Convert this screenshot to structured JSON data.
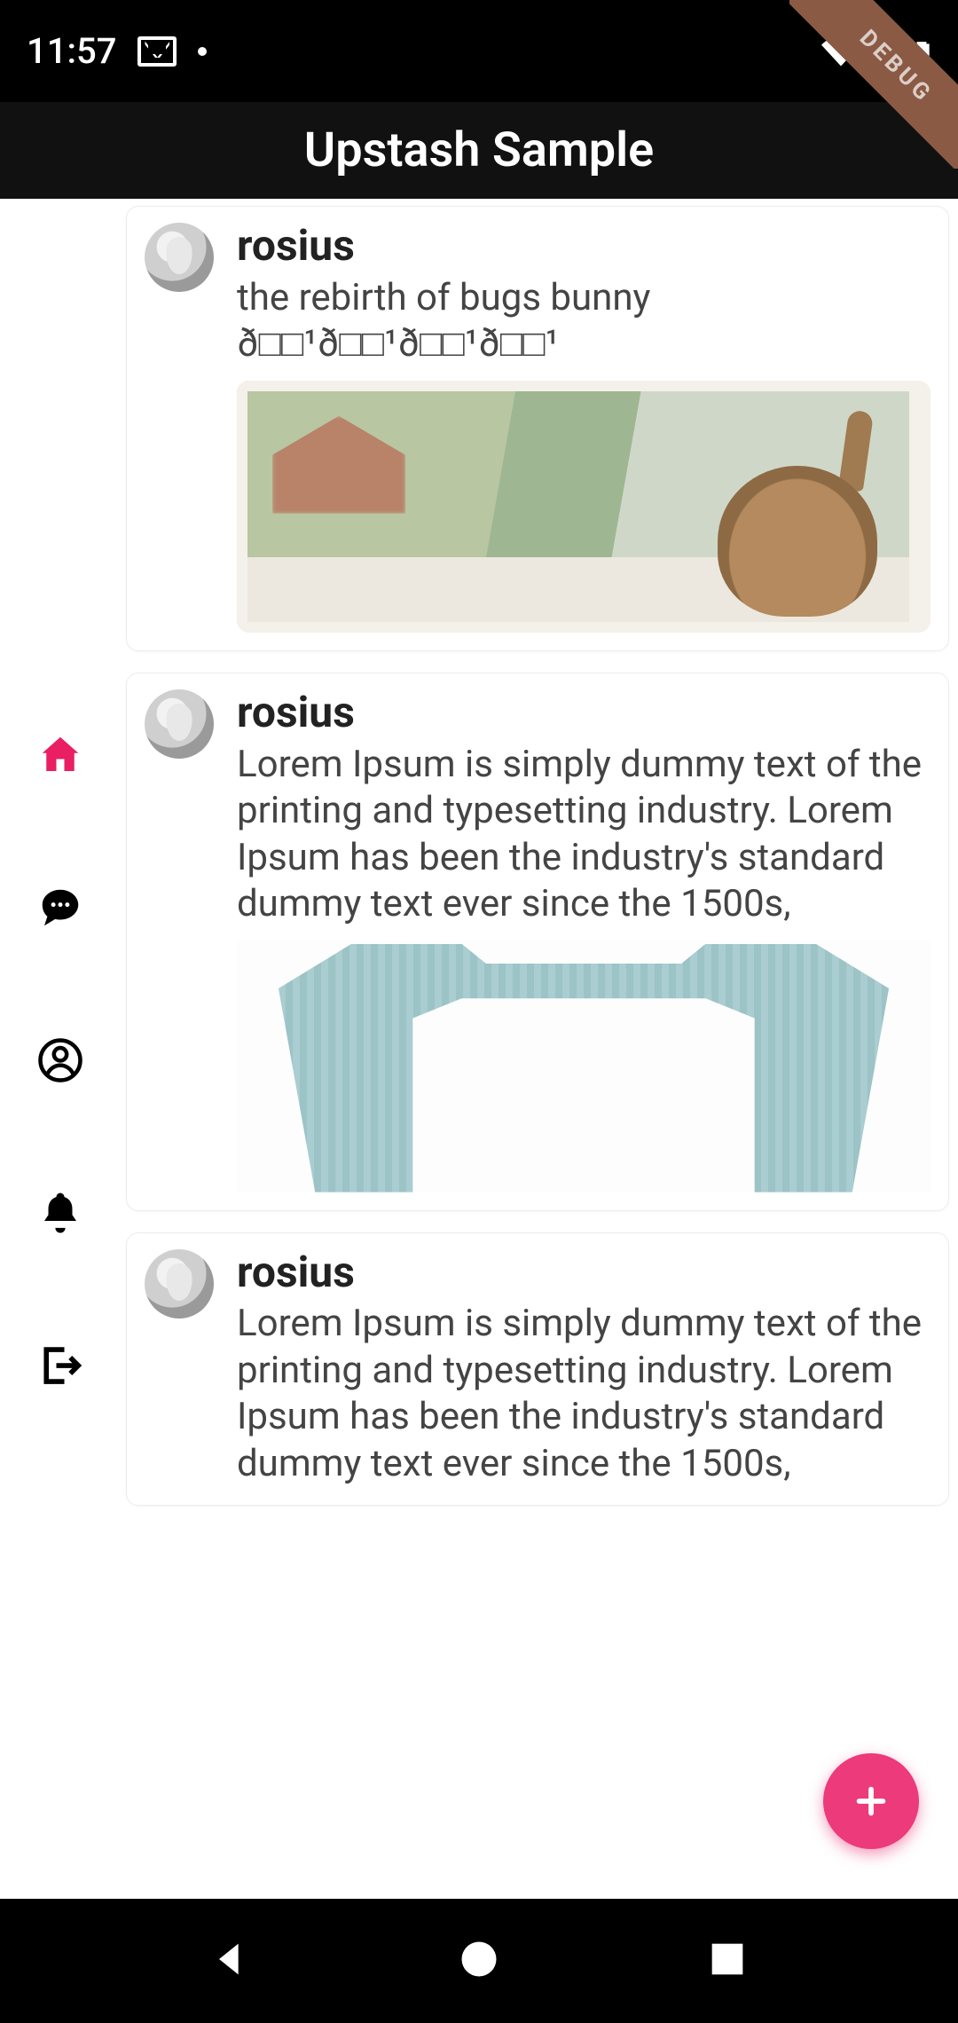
{
  "statusbar": {
    "time": "11:57"
  },
  "debug_label": "DEBUG",
  "appbar": {
    "title": "Upstash Sample"
  },
  "sidebar": {
    "items": [
      {
        "name": "home",
        "active": true
      },
      {
        "name": "chat",
        "active": false
      },
      {
        "name": "profile",
        "active": false
      },
      {
        "name": "notifications",
        "active": false
      },
      {
        "name": "logout",
        "active": false
      }
    ]
  },
  "colors": {
    "accent": "#ec3a7a"
  },
  "posts": [
    {
      "username": "rosius",
      "caption": "the rebirth of bugs bunny ð□□¹ð□□¹ð□□¹ð□□¹",
      "image": "bunny"
    },
    {
      "username": "rosius",
      "caption": "Lorem Ipsum is simply dummy text of the printing and typesetting industry. Lorem Ipsum has been the industry's standard dummy text ever since the 1500s,",
      "image": "sweater"
    },
    {
      "username": "rosius",
      "caption": "Lorem Ipsum is simply dummy text of the printing and typesetting industry. Lorem Ipsum has been the industry's standard dummy text ever since the 1500s,",
      "image": null
    }
  ],
  "fab": {
    "label": "add"
  }
}
